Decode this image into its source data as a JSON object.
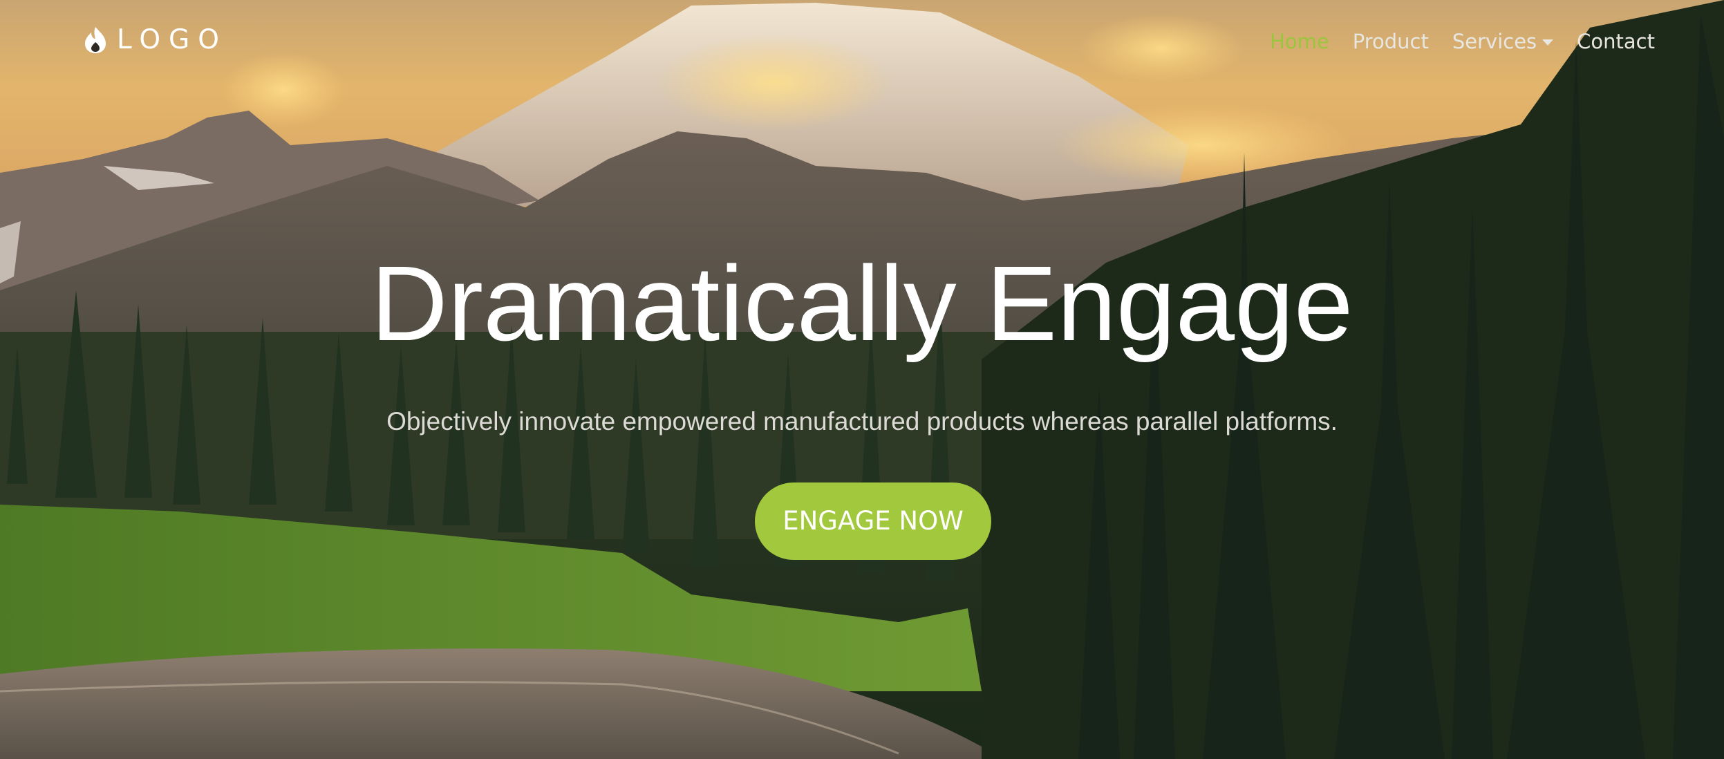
{
  "brand": {
    "logo_text": "LOGO",
    "logo_icon": "flame-icon"
  },
  "nav": {
    "items": [
      {
        "label": "Home",
        "active": true
      },
      {
        "label": "Product",
        "active": false
      },
      {
        "label": "Services",
        "active": false,
        "has_dropdown": true
      },
      {
        "label": "Contact",
        "active": false
      }
    ],
    "dropdown_icon": "caret-down-icon"
  },
  "hero": {
    "title": "Dramatically Engage",
    "subtitle": "Objectively innovate empowered manufactured products whereas parallel platforms.",
    "cta_label": "ENGAGE NOW",
    "background": "mountain-forest-lake-photo"
  },
  "colors": {
    "accent": "#a2c83e",
    "active_nav": "#9cc53f",
    "text": "#ffffff"
  }
}
